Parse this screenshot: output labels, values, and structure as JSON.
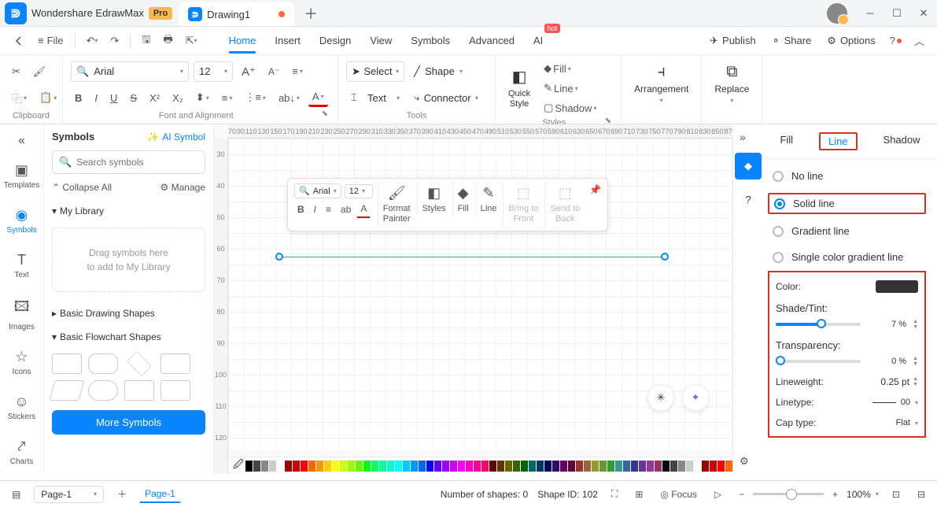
{
  "app": {
    "name": "Wondershare EdrawMax",
    "badge": "Pro"
  },
  "tab": {
    "title": "Drawing1"
  },
  "menubar": {
    "file": "File",
    "tabs": [
      "Home",
      "Insert",
      "Design",
      "View",
      "Symbols",
      "Advanced",
      "AI"
    ],
    "active": 0,
    "hot": "hot",
    "publish": "Publish",
    "share": "Share",
    "options": "Options"
  },
  "ribbon": {
    "clipboard": "Clipboard",
    "font": "Arial",
    "size": "12",
    "font_align": "Font and Alignment",
    "select": "Select",
    "shape": "Shape",
    "text": "Text",
    "connector": "Connector",
    "tools": "Tools",
    "quick_style": "Quick\nStyle",
    "fill": "Fill",
    "line": "Line",
    "shadow": "Shadow",
    "styles": "Styles",
    "arrangement": "Arrangement",
    "replace": "Replace"
  },
  "rail": {
    "items": [
      "Templates",
      "Symbols",
      "Text",
      "Images",
      "Icons",
      "Stickers",
      "Charts"
    ],
    "active": 1
  },
  "symbols": {
    "title": "Symbols",
    "ai": "AI Symbol",
    "search_placeholder": "Search symbols",
    "collapse": "Collapse All",
    "manage": "Manage",
    "my_library": "My Library",
    "drop_hint1": "Drag symbols here",
    "drop_hint2": "to add to My Library",
    "basic_drawing": "Basic Drawing Shapes",
    "basic_flowchart": "Basic Flowchart Shapes",
    "more": "More Symbols"
  },
  "ruler_h": [
    "70",
    "110",
    "150",
    "190",
    "230",
    "270",
    "310",
    "350",
    "390",
    "430",
    "470",
    "510",
    "550",
    "590",
    "630",
    "670",
    "710",
    "750",
    "790",
    "830",
    "870"
  ],
  "ruler_h2": [
    "90",
    "130",
    "170",
    "210",
    "250",
    "290",
    "330",
    "370",
    "410",
    "450",
    "490",
    "530",
    "570",
    "610",
    "650",
    "690",
    "730",
    "770",
    "810",
    "850"
  ],
  "ruler_v": [
    "30",
    "40",
    "50",
    "60",
    "70",
    "80",
    "90",
    "100",
    "110",
    "120"
  ],
  "float": {
    "font": "Arial",
    "size": "12",
    "format_painter": "Format\nPainter",
    "styles": "Styles",
    "fill": "Fill",
    "line": "Line",
    "bring_front": "Bring to\nFront",
    "send_back": "Send to\nBack"
  },
  "right": {
    "tabs": [
      "Fill",
      "Line",
      "Shadow"
    ],
    "active": 1,
    "no_line": "No line",
    "solid_line": "Solid line",
    "gradient_line": "Gradient line",
    "single_gradient": "Single color gradient line",
    "color": "Color:",
    "shade": "Shade/Tint:",
    "shade_val": "7 %",
    "transparency": "Transparency:",
    "trans_val": "0 %",
    "lineweight": "Lineweight:",
    "lineweight_val": "0.25 pt",
    "linetype": "Linetype:",
    "linetype_val": "00",
    "cap": "Cap type:",
    "cap_val": "Flat"
  },
  "status": {
    "page_sel": "Page-1",
    "page_tab": "Page-1",
    "shapes": "Number of shapes: 0",
    "shape_id": "Shape ID: 102",
    "focus": "Focus",
    "zoom": "100%"
  }
}
